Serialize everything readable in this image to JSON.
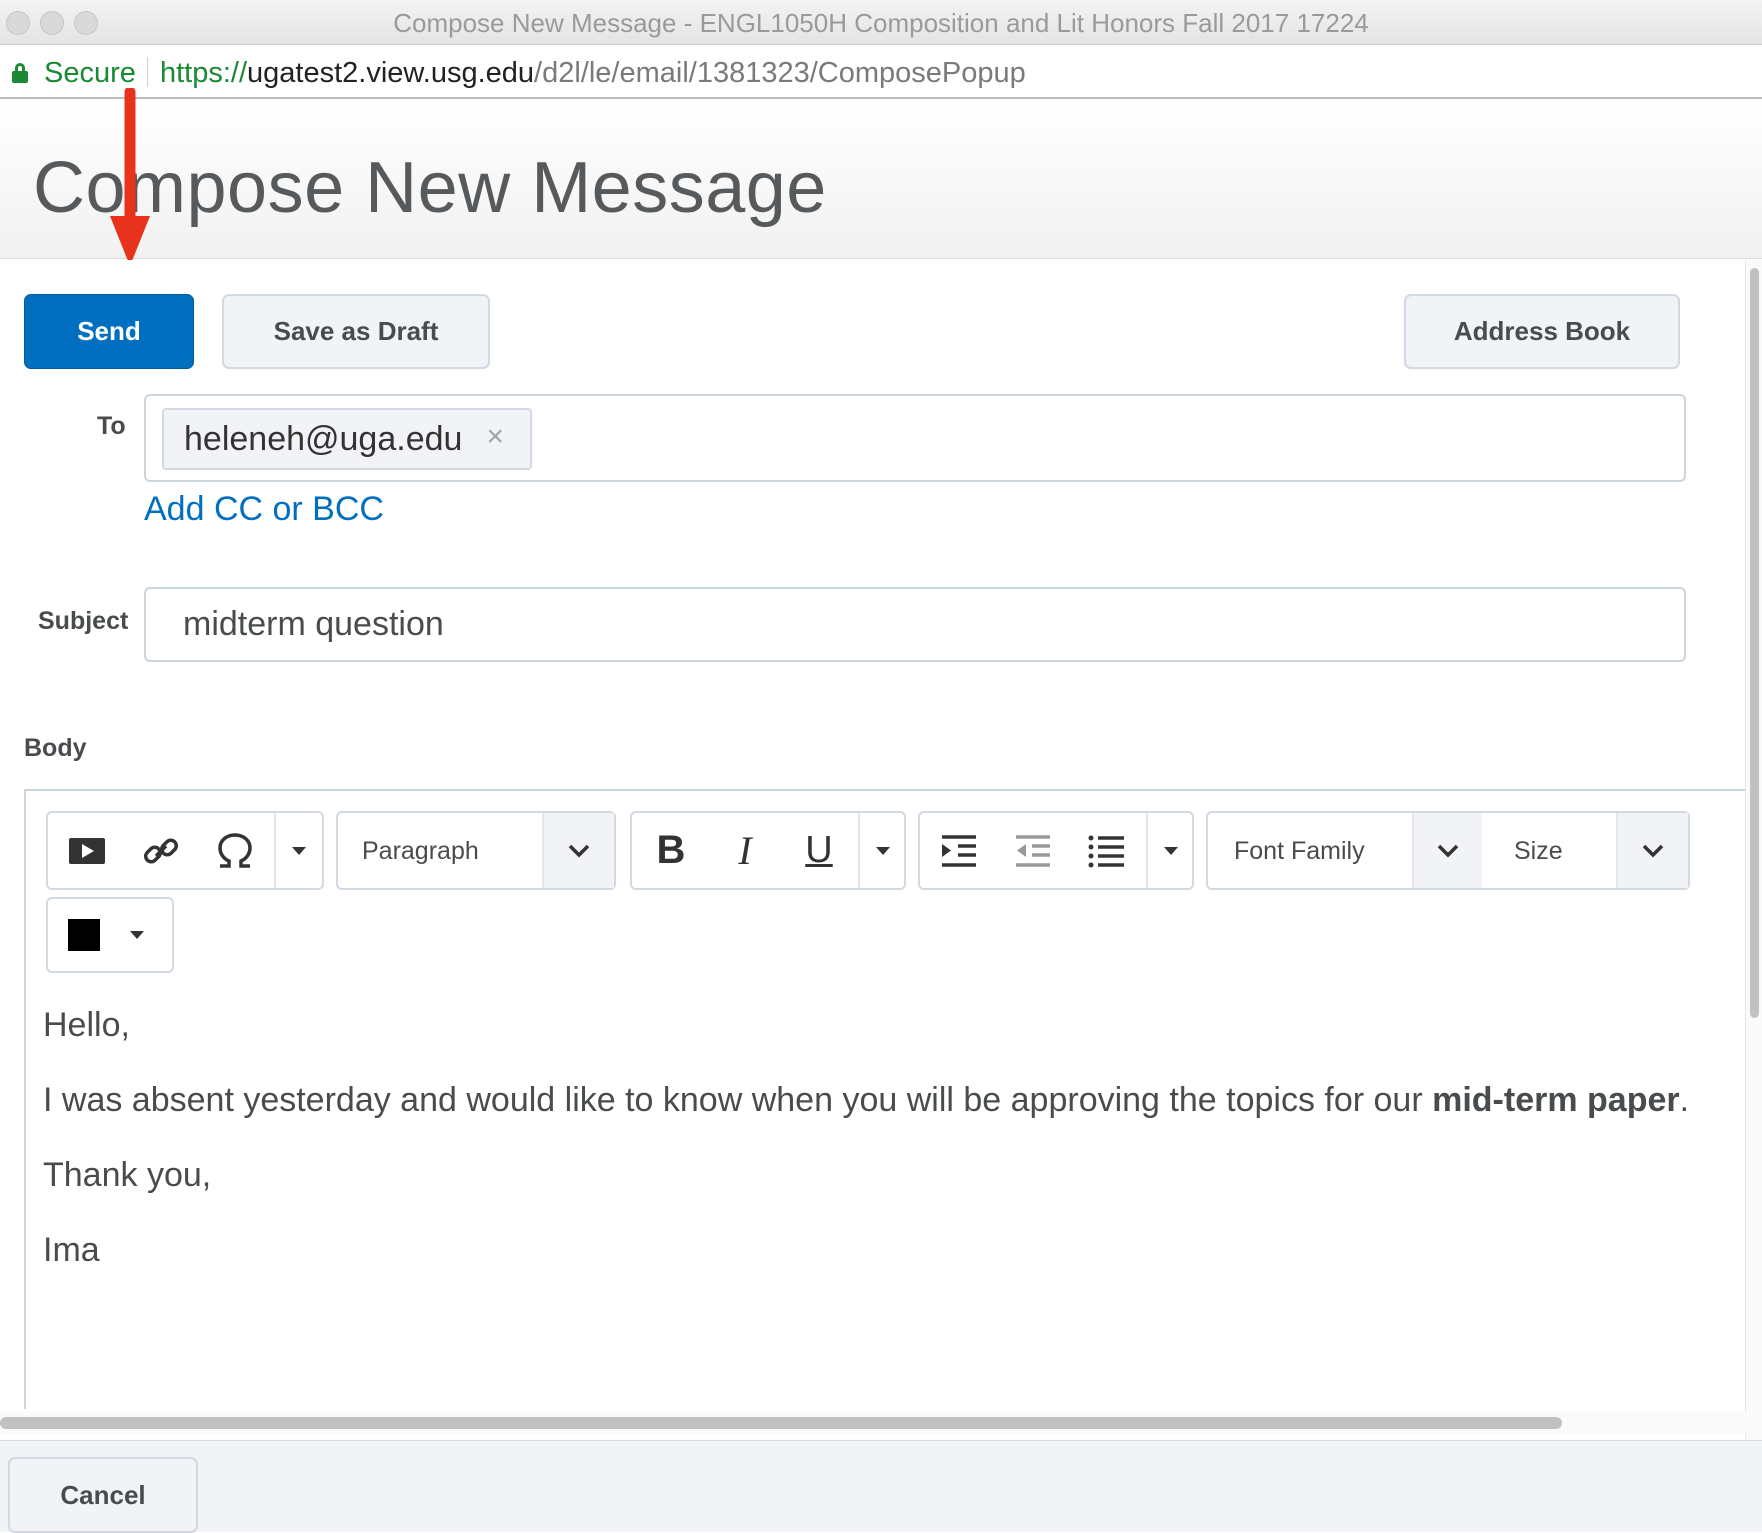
{
  "window": {
    "title": "Compose New Message - ENGL1050H Composition and Lit Honors Fall 2017 17224"
  },
  "addressbar": {
    "secure_label": "Secure",
    "url_scheme": "https://",
    "url_host": "ugatest2.view.usg.edu",
    "url_path": "/d2l/le/email/1381323/ComposePopup"
  },
  "page": {
    "title": "Compose New Message"
  },
  "actions": {
    "send": "Send",
    "save_draft": "Save as Draft",
    "address_book": "Address Book",
    "cancel": "Cancel"
  },
  "to": {
    "label": "To",
    "recipients": [
      "heleneh@uga.edu"
    ],
    "remove_glyph": "×",
    "add_cc_bcc": "Add CC or BCC"
  },
  "subject": {
    "label": "Subject",
    "value": "midterm question"
  },
  "body": {
    "label": "Body",
    "toolbar": {
      "insert_group_icons": [
        "video-icon",
        "link-icon",
        "omega-icon"
      ],
      "block_format": "Paragraph",
      "text_style_icons": [
        "bold-icon",
        "italic-icon",
        "underline-icon"
      ],
      "list_icons": [
        "indent-icon",
        "outdent-icon",
        "bulleted-list-icon"
      ],
      "font_family": "Font Family",
      "font_size": "Size",
      "text_color": "#000000"
    },
    "lines": {
      "greeting": "Hello,",
      "paragraph_before": "I was absent yesterday and would like to know when you will be approving the topics for our ",
      "paragraph_bold": "mid-term paper",
      "paragraph_after": ".",
      "closing": "Thank you,",
      "signature": "Ima"
    }
  },
  "colors": {
    "primary": "#006fbf",
    "annotation_arrow": "#e8321c"
  }
}
